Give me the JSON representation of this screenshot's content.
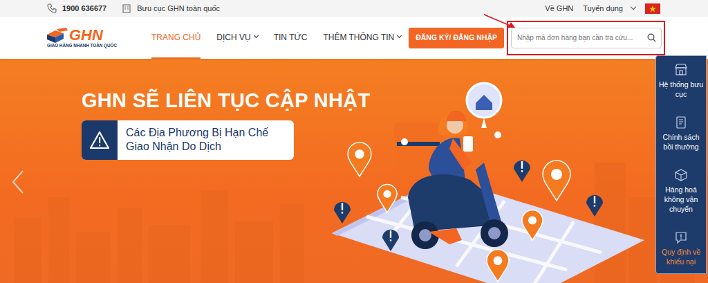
{
  "topbar": {
    "phone": "1900 636677",
    "post_offices": "Bưu cục GHN toàn quốc",
    "links": [
      {
        "label": "Về GHN"
      },
      {
        "label": "Tuyển dụng"
      }
    ],
    "language": {
      "expanded": false
    }
  },
  "logo": {
    "brand": "GHN",
    "tagline": "GIAO HÀNG NHANH TOÀN QUỐC"
  },
  "nav": [
    {
      "label": "TRANG CHỦ",
      "selected": true,
      "dropdown": false
    },
    {
      "label": "DỊCH VỤ",
      "selected": false,
      "dropdown": true
    },
    {
      "label": "TIN TỨC",
      "selected": false,
      "dropdown": false
    },
    {
      "label": "THÊM THÔNG TIN",
      "selected": false,
      "dropdown": true
    }
  ],
  "auth_button": "ĐĂNG KÝ/ ĐĂNG NHẬP",
  "search": {
    "placeholder": "Nhập mã đơn hàng bạn cần tra cứu..."
  },
  "hero": {
    "headline": "GHN SẼ LIÊN TỤC CẬP NHẬT",
    "notice_lines": [
      "Các Địa Phương Bị Hạn Chế",
      "Giao Nhận Do Dịch"
    ]
  },
  "sidebar": {
    "items": [
      {
        "label": "Hệ thống bưu cục",
        "highlighted": false
      },
      {
        "label": "Chính sách bồi thường",
        "highlighted": false
      },
      {
        "label": "Hàng hoá không vận chuyển",
        "highlighted": false
      },
      {
        "label": "Quy định về khiếu nại",
        "highlighted": true
      }
    ]
  }
}
